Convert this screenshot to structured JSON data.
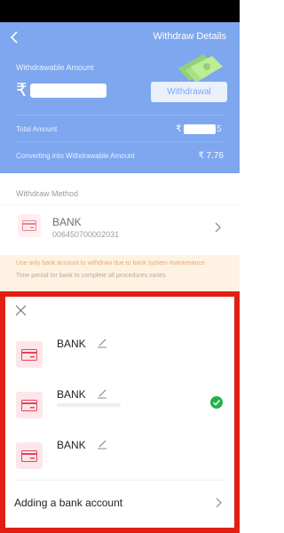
{
  "header": {
    "title": "Withdraw Details",
    "withdrawable_label": "Withdrawable Amount",
    "rupee_symbol": "₹",
    "withdrawal_button": "Withdrawal",
    "total_label": "Total Amount",
    "total_rupee": "₹",
    "total_tail": "5",
    "converting_label": "Converting into Withdrawable Amount",
    "converting_value": "₹ 7.76"
  },
  "method": {
    "label": "Withdraw Method",
    "bank_name": "BANK",
    "account_number": "006450700002031"
  },
  "notice": {
    "line1": "Use only bank account to withdraw due to bank system maintenance",
    "line2": "Time period for bank to complete all procedures varies"
  },
  "sheet": {
    "accounts": [
      {
        "name": "BANK",
        "selected": false
      },
      {
        "name": "BANK",
        "selected": true
      },
      {
        "name": "BANK",
        "selected": false
      }
    ],
    "add_account": "Adding a bank account"
  },
  "colors": {
    "primary": "#3a78e8",
    "highlight_border": "#e11f12",
    "selected_check": "#22b14c",
    "card_bg": "#fde6ea",
    "card_icon": "#e0445a"
  }
}
